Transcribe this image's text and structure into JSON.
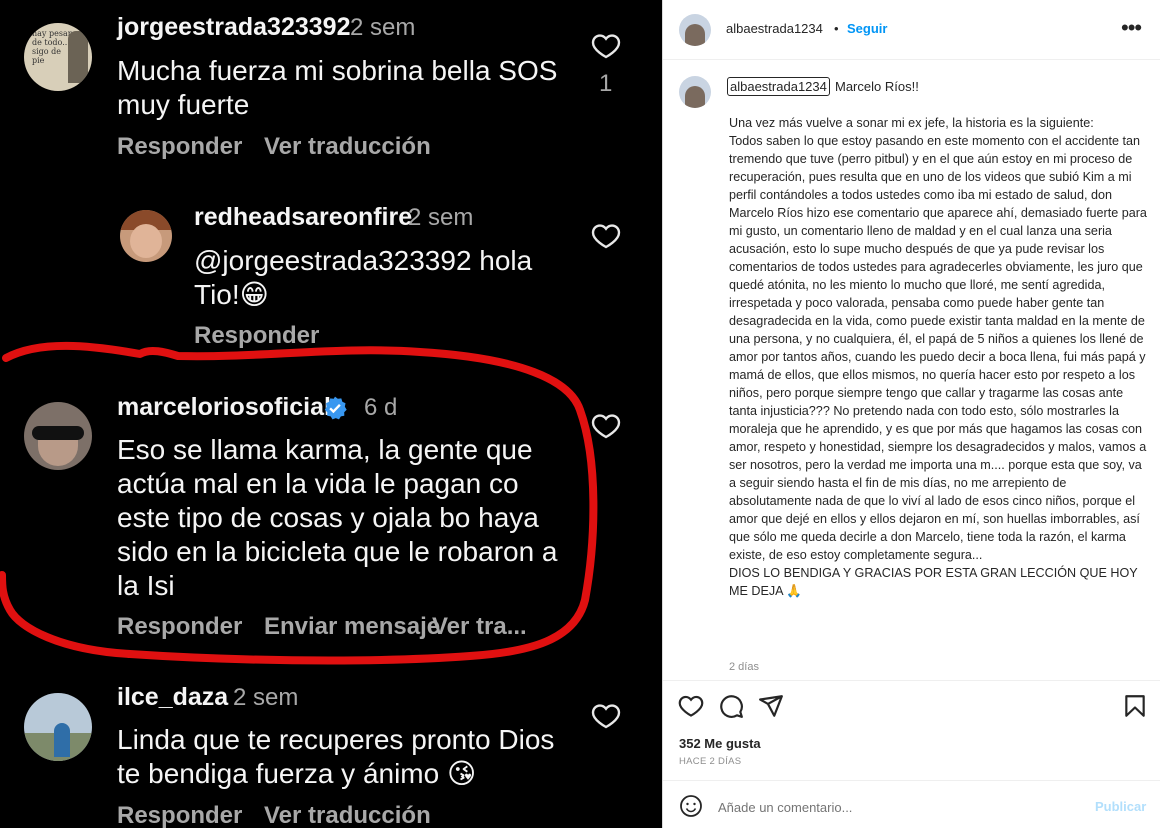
{
  "comments": [
    {
      "username": "jorgeestrada323392",
      "time": "2 sem",
      "text": "Mucha fuerza mi sobrina bella SOS muy fuerte",
      "actions": [
        "Responder",
        "Ver traducción"
      ],
      "likes": "1",
      "avatar_text": "hay pesar de todo... sigo de pie"
    },
    {
      "username": "redheadsareonfire",
      "time": "2 sem",
      "text": "@jorgeestrada323392 hola Tio!😁",
      "actions": [
        "Responder"
      ]
    },
    {
      "username": "marceloriosoficial",
      "verified": true,
      "time": "6 d",
      "text": "Eso se llama karma, la gente que actúa mal en la vida le pagan co este tipo de cosas y ojala bo haya sido en la bicicleta que le robaron a la Isi",
      "actions": [
        "Responder",
        "Enviar mensaje",
        "Ver tra..."
      ]
    },
    {
      "username": "ilce_daza",
      "time": "2 sem",
      "text": "Linda que te recuperes pronto Dios te bendiga fuerza y ánimo 😘",
      "actions": [
        "Responder",
        "Ver traducción"
      ]
    }
  ],
  "post": {
    "author": "albaestrada1234",
    "follow_sep": "•",
    "follow_label": "Seguir",
    "caption_user": "albaestrada1234",
    "caption_head": "Marcelo Ríos!!",
    "caption_body": "Una vez más vuelve a sonar mi ex jefe, la historia es la siguiente:\nTodos saben lo que estoy pasando en este momento con el accidente tan tremendo que tuve (perro pitbul) y en el que aún estoy en mi proceso de recuperación, pues resulta que en uno de los videos que subió Kim a mi perfil contándoles a todos ustedes como iba mi estado de salud, don Marcelo Ríos hizo ese comentario que aparece ahí, demasiado fuerte para mi gusto, un comentario lleno de maldad y en el cual lanza una seria acusación, esto lo supe mucho después de que ya pude revisar los comentarios de todos ustedes para agradecerles obviamente, les juro que quedé atónita, no les miento lo mucho que lloré, me sentí agredida, irrespetada y poco valorada, pensaba como puede haber gente tan desagradecida en la vida, como puede existir tanta maldad en la mente de una persona, y no cualquiera, él, el papá de 5 niños a quienes los llené de amor por tantos años, cuando les puedo decir a boca llena, fui más papá y mamá de ellos, que ellos mismos, no quería hacer esto por respeto a los niños, pero porque siempre tengo que callar y tragarme las cosas ante tanta injusticia??? No pretendo nada con todo esto, sólo mostrarles la moraleja que he aprendido, y es que por más que hagamos las cosas con amor, respeto y honestidad, siempre los desagradecidos y malos, vamos a ser nosotros, pero la verdad me importa una m.... porque esta que soy, va a seguir siendo hasta el fin de mis días, no me arrepiento de absolutamente nada de que lo viví al lado de esos cinco niños, porque el amor que dejé en ellos y ellos dejaron en mí, son huellas imborrables, así que sólo me queda decirle a don Marcelo, tiene toda la razón, el karma existe, de eso estoy completamente segura...\nDIOS LO BENDIGA Y GRACIAS POR ESTA GRAN LECCIÓN QUE HOY ME DEJA 🙏",
    "caption_time": "2 días",
    "likes": "352 Me gusta",
    "posted_ago": "HACE 2 DÍAS",
    "comment_placeholder": "Añade un comentario...",
    "publish_label": "Publicar"
  },
  "colors": {
    "annotation_red": "#e01010",
    "verified_blue": "#3897f0",
    "link_blue": "#0095f6"
  }
}
